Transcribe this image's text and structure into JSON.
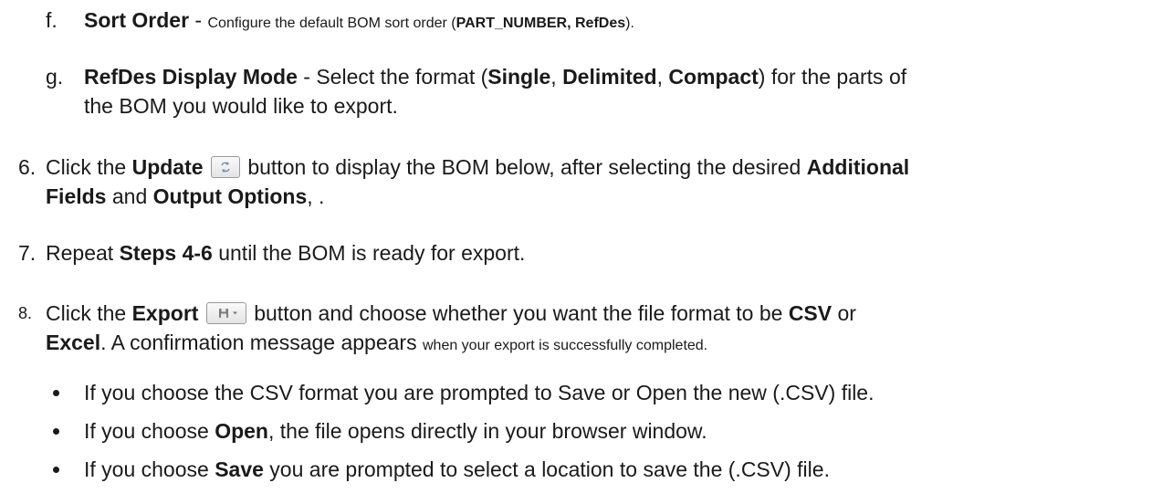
{
  "items": {
    "f": {
      "marker": "f.",
      "title": "Sort Order",
      "dash": " - ",
      "text1": "Configure the default BOM sort order (",
      "bold1": "PART_NUMBER, RefDes",
      "text2": ")."
    },
    "g": {
      "marker": "g.",
      "title": "RefDes Display Mode",
      "text1": " - Select the format (",
      "opt1": "Single",
      "sep1": ", ",
      "opt2": "Delimited",
      "sep2": ", ",
      "opt3": "Compact",
      "text2": ") for the parts of",
      "line2": "the BOM you would like to export."
    },
    "s6": {
      "marker": "6.",
      "text1": "Click the ",
      "bold1": "Update",
      "text2": " button to display the BOM below, after selecting the desired ",
      "bold2": "Additional",
      "bold3": "Fields",
      "text3": " and ",
      "bold4": "Output Options",
      "text4": ", ."
    },
    "s7": {
      "marker": "7.",
      "text1": "Repeat ",
      "bold1": "Steps 4-6",
      "text2": " until the BOM is ready for export."
    },
    "s8": {
      "marker": "8.",
      "text1": "Click the ",
      "bold1": "Export",
      "text2": " button and choose whether you want the file format to be ",
      "bold2": "CSV",
      "text3": " or",
      "bold3": "Excel",
      "text4": ". A confirmation message appears ",
      "text5": "when your export is successfully completed."
    },
    "bullets": {
      "b1": "If you choose the CSV format you are prompted to Save or Open the new (.CSV) file.",
      "b2_pre": "If you choose ",
      "b2_bold": "Open",
      "b2_post": ", the file opens directly in your browser window.",
      "b3_pre": "If you choose ",
      "b3_bold": "Save",
      "b3_post": " you are prompted to select a location to save the (.CSV) file."
    }
  }
}
